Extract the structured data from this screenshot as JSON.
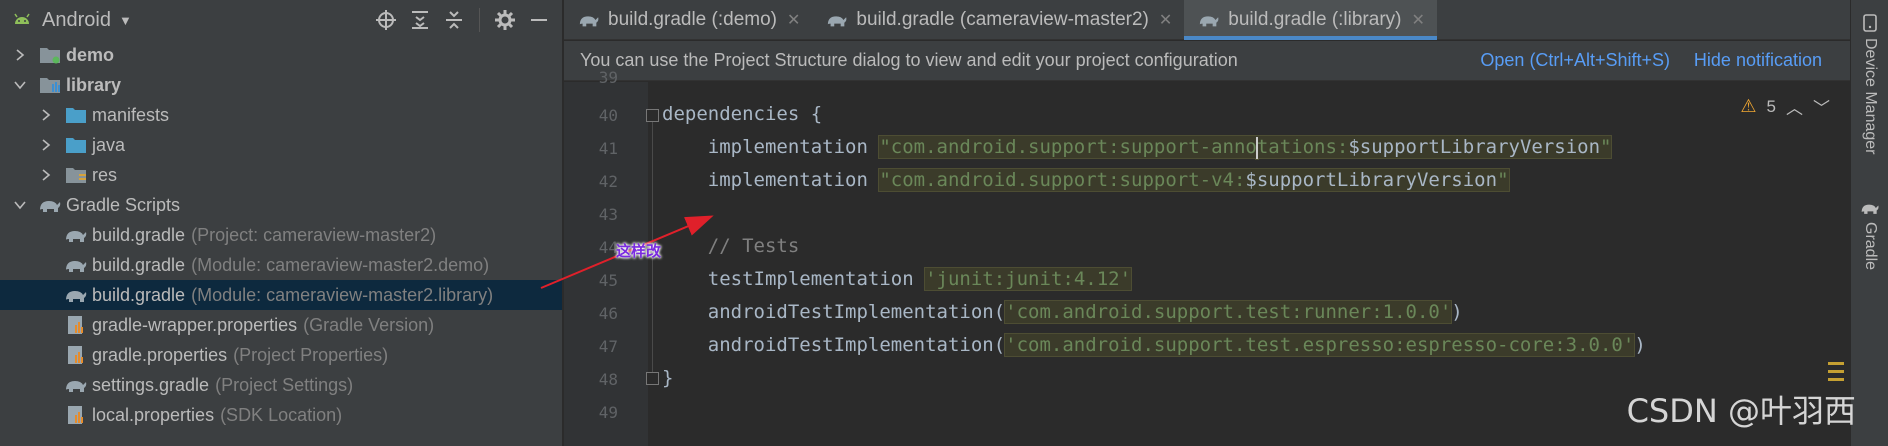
{
  "project_panel": {
    "view_name": "Android",
    "tree": [
      {
        "label": "demo",
        "hint": "",
        "bold": true,
        "icon": "module-folder-icon",
        "arrow": "right"
      },
      {
        "label": "library",
        "hint": "",
        "bold": true,
        "icon": "library-folder-icon",
        "arrow": "down"
      },
      {
        "label": "manifests",
        "hint": "",
        "bold": false,
        "icon": "folder-icon",
        "arrow": "right"
      },
      {
        "label": "java",
        "hint": "",
        "bold": false,
        "icon": "folder-icon",
        "arrow": "right"
      },
      {
        "label": "res",
        "hint": "",
        "bold": false,
        "icon": "res-folder-icon",
        "arrow": "right"
      },
      {
        "label": "Gradle Scripts",
        "hint": "",
        "bold": false,
        "icon": "gradle-icon",
        "arrow": "down"
      },
      {
        "label": "build.gradle",
        "hint": "(Project: cameraview-master2)",
        "bold": false,
        "icon": "gradle-icon",
        "arrow": ""
      },
      {
        "label": "build.gradle",
        "hint": "(Module: cameraview-master2.demo)",
        "bold": false,
        "icon": "gradle-icon",
        "arrow": ""
      },
      {
        "label": "build.gradle",
        "hint": "(Module: cameraview-master2.library)",
        "bold": false,
        "icon": "gradle-icon",
        "arrow": "",
        "selected": true
      },
      {
        "label": "gradle-wrapper.properties",
        "hint": "(Gradle Version)",
        "bold": false,
        "icon": "properties-icon",
        "arrow": ""
      },
      {
        "label": "gradle.properties",
        "hint": "(Project Properties)",
        "bold": false,
        "icon": "properties-icon",
        "arrow": ""
      },
      {
        "label": "settings.gradle",
        "hint": "(Project Settings)",
        "bold": false,
        "icon": "gradle-icon",
        "arrow": ""
      },
      {
        "label": "local.properties",
        "hint": "(SDK Location)",
        "bold": false,
        "icon": "properties-icon",
        "arrow": ""
      }
    ]
  },
  "tabs": [
    {
      "label": "build.gradle (:demo)",
      "active": false
    },
    {
      "label": "build.gradle (cameraview-master2)",
      "active": false
    },
    {
      "label": "build.gradle (:library)",
      "active": true
    }
  ],
  "notification": {
    "message": "You can use the Project Structure dialog to view and edit your project configuration",
    "open_link": "Open (Ctrl+Alt+Shift+S)",
    "hide_link": "Hide notification"
  },
  "editor": {
    "line_numbers": [
      "39",
      "40",
      "41",
      "42",
      "43",
      "44",
      "45",
      "46",
      "47",
      "48",
      "49"
    ],
    "lines": {
      "l40_kw": "dependencies {",
      "l41_kw": "    implementation ",
      "l41_str_a": "\"com.android.support:support-anno",
      "l41_str_b": "tations:",
      "l41_var": "$supportLibraryVersion",
      "l41_end": "\"",
      "l42_kw": "    implementation ",
      "l42_str": "\"com.android.support:support-v4:",
      "l42_var": "$supportLibraryVersion",
      "l42_end": "\"",
      "l44_cmt": "    // Tests",
      "l45_kw": "    testImplementation ",
      "l45_str": "'junit:junit:4.12'",
      "l46_kw": "    androidTestImplementation(",
      "l46_str": "'com.android.support.test:runner:1.0.0'",
      "l46_end": ")",
      "l47_kw": "    androidTestImplementation(",
      "l47_str": "'com.android.support.test.espresso:espresso-core:3.0.0'",
      "l47_end": ")",
      "l48_kw": "}"
    },
    "warning_count": "5"
  },
  "right_strip": {
    "device_manager": "Device Manager",
    "gradle": "Gradle"
  },
  "annotation": {
    "text": "这样改"
  },
  "watermark": "CSDN @叶羽西",
  "colors": {
    "accent": "#4a88c7",
    "link": "#589df6",
    "annotation_arrow": "#e0202a",
    "annotation_text": "#7a2be0"
  }
}
